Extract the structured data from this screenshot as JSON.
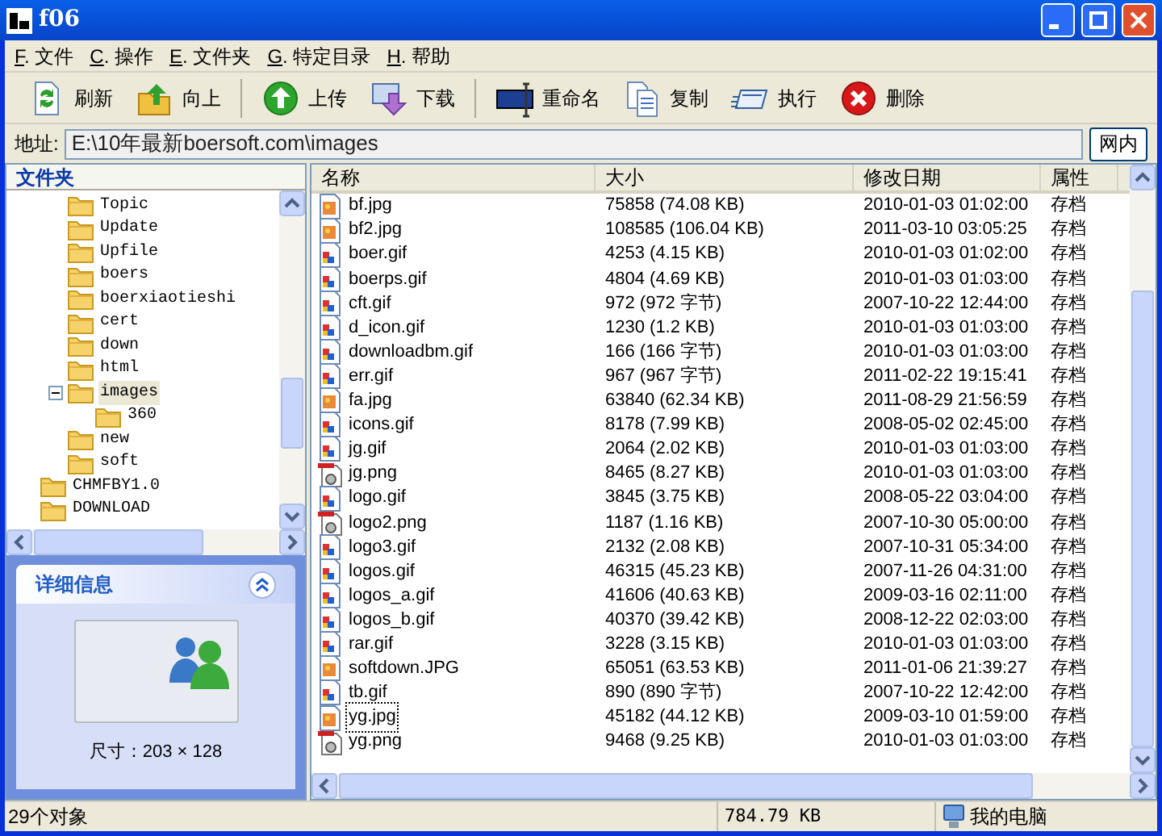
{
  "window": {
    "title": "f06"
  },
  "menu": [
    "F. 文件",
    "C. 操作",
    "E. 文件夹",
    "G. 特定目录",
    "H. 帮助"
  ],
  "toolbar": [
    {
      "label": "刷新",
      "kind": "refresh",
      "separator_before": false
    },
    {
      "label": "向上",
      "kind": "up",
      "separator_before": false
    },
    {
      "label": "上传",
      "kind": "upload",
      "separator_before": true
    },
    {
      "label": "下载",
      "kind": "download",
      "separator_before": false
    },
    {
      "label": "重命名",
      "kind": "rename",
      "separator_before": true
    },
    {
      "label": "复制",
      "kind": "copy",
      "separator_before": false
    },
    {
      "label": "执行",
      "kind": "execute",
      "separator_before": false
    },
    {
      "label": "删除",
      "kind": "delete",
      "separator_before": false
    }
  ],
  "address": {
    "label": "地址:",
    "value": "E:\\10年最新boersoft.com\\images",
    "button": "网内"
  },
  "folders": {
    "title": "文件夹",
    "items": [
      {
        "children": [
          {
            "label": "Topic",
            "selected": false
          },
          {
            "label": "Update",
            "selected": false
          },
          {
            "label": "Upfile",
            "selected": false
          },
          {
            "label": "boers",
            "selected": false
          },
          {
            "label": "boerxiaotieshi",
            "selected": false
          },
          {
            "label": "cert",
            "selected": false
          },
          {
            "label": "down",
            "selected": false
          },
          {
            "label": "html",
            "selected": false
          },
          {
            "label": "images",
            "expanded": true,
            "selected": true,
            "children": [
              {
                "label": "360",
                "selected": false
              }
            ]
          },
          {
            "label": "new",
            "selected": false
          },
          {
            "label": "soft",
            "selected": false
          }
        ]
      },
      {
        "label": "CHMFBY1.0",
        "selected": false
      },
      {
        "label": "DOWNLOAD",
        "selected": false
      }
    ]
  },
  "details": {
    "title": "详细信息",
    "size": "尺寸：203 × 128"
  },
  "table": {
    "columns": [
      "名称",
      "大小",
      "修改日期",
      "属性"
    ],
    "rows": [
      {
        "kind": "jpg",
        "selected": false,
        "cells": [
          "bf.jpg",
          "75858 (74.08 KB)",
          "2010-01-03 01:02:00",
          "存档"
        ]
      },
      {
        "kind": "jpg",
        "selected": false,
        "cells": [
          "bf2.jpg",
          "108585 (106.04 KB)",
          "2011-03-10 03:05:25",
          "存档"
        ]
      },
      {
        "kind": "gif",
        "selected": false,
        "cells": [
          "boer.gif",
          "4253 (4.15 KB)",
          "2010-01-03 01:02:00",
          "存档"
        ]
      },
      {
        "kind": "gif",
        "selected": false,
        "cells": [
          "boerps.gif",
          "4804 (4.69 KB)",
          "2010-01-03 01:03:00",
          "存档"
        ]
      },
      {
        "kind": "gif",
        "selected": false,
        "cells": [
          "cft.gif",
          "972 (972 字节)",
          "2007-10-22 12:44:00",
          "存档"
        ]
      },
      {
        "kind": "gif",
        "selected": false,
        "cells": [
          "d_icon.gif",
          "1230 (1.2 KB)",
          "2010-01-03 01:03:00",
          "存档"
        ]
      },
      {
        "kind": "gif",
        "selected": false,
        "cells": [
          "downloadbm.gif",
          "166 (166 字节)",
          "2010-01-03 01:03:00",
          "存档"
        ]
      },
      {
        "kind": "gif",
        "selected": false,
        "cells": [
          "err.gif",
          "967 (967 字节)",
          "2011-02-22 19:15:41",
          "存档"
        ]
      },
      {
        "kind": "jpg",
        "selected": false,
        "cells": [
          "fa.jpg",
          "63840 (62.34 KB)",
          "2011-08-29 21:56:59",
          "存档"
        ]
      },
      {
        "kind": "gif",
        "selected": false,
        "cells": [
          "icons.gif",
          "8178 (7.99 KB)",
          "2008-05-02 02:45:00",
          "存档"
        ]
      },
      {
        "kind": "gif",
        "selected": false,
        "cells": [
          "jg.gif",
          "2064 (2.02 KB)",
          "2010-01-03 01:03:00",
          "存档"
        ]
      },
      {
        "kind": "png",
        "selected": false,
        "cells": [
          "jg.png",
          "8465 (8.27 KB)",
          "2010-01-03 01:03:00",
          "存档"
        ]
      },
      {
        "kind": "gif",
        "selected": false,
        "cells": [
          "logo.gif",
          "3845 (3.75 KB)",
          "2008-05-22 03:04:00",
          "存档"
        ]
      },
      {
        "kind": "png",
        "selected": false,
        "cells": [
          "logo2.png",
          "1187 (1.16 KB)",
          "2007-10-30 05:00:00",
          "存档"
        ]
      },
      {
        "kind": "gif",
        "selected": false,
        "cells": [
          "logo3.gif",
          "2132 (2.08 KB)",
          "2007-10-31 05:34:00",
          "存档"
        ]
      },
      {
        "kind": "gif",
        "selected": false,
        "cells": [
          "logos.gif",
          "46315 (45.23 KB)",
          "2007-11-26 04:31:00",
          "存档"
        ]
      },
      {
        "kind": "gif",
        "selected": false,
        "cells": [
          "logos_a.gif",
          "41606 (40.63 KB)",
          "2009-03-16 02:11:00",
          "存档"
        ]
      },
      {
        "kind": "gif",
        "selected": false,
        "cells": [
          "logos_b.gif",
          "40370 (39.42 KB)",
          "2008-12-22 02:03:00",
          "存档"
        ]
      },
      {
        "kind": "gif",
        "selected": false,
        "cells": [
          "rar.gif",
          "3228 (3.15 KB)",
          "2010-01-03 01:03:00",
          "存档"
        ]
      },
      {
        "kind": "jpg",
        "selected": false,
        "cells": [
          "softdown.JPG",
          "65051 (63.53 KB)",
          "2011-01-06 21:39:27",
          "存档"
        ]
      },
      {
        "kind": "gif",
        "selected": false,
        "cells": [
          "tb.gif",
          "890 (890 字节)",
          "2007-10-22 12:42:00",
          "存档"
        ]
      },
      {
        "kind": "jpg",
        "selected": true,
        "cells": [
          "yg.jpg",
          "45182 (44.12 KB)",
          "2009-03-10 01:59:00",
          "存档"
        ]
      },
      {
        "kind": "png",
        "selected": false,
        "cells": [
          "yg.png",
          "9468 (9.25 KB)",
          "2010-01-03 01:03:00",
          "存档"
        ]
      }
    ]
  },
  "status_bar": [
    "29个对象",
    "784.79 KB",
    "我的电脑"
  ]
}
